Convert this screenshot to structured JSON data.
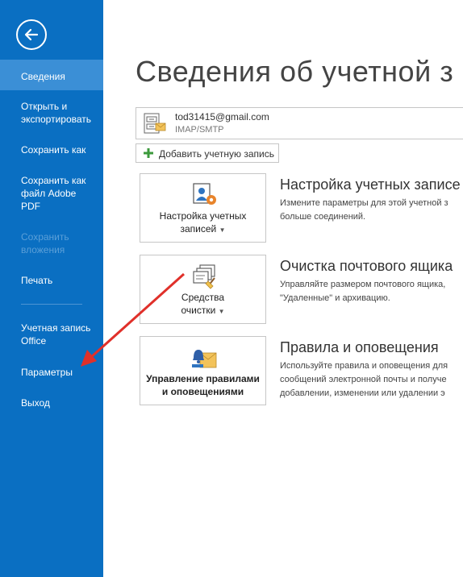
{
  "sidebar": {
    "back_icon": "back-arrow-icon",
    "items": [
      {
        "label": "Сведения"
      },
      {
        "label": "Открыть и экспортировать"
      },
      {
        "label": "Сохранить как"
      },
      {
        "label": "Сохранить как файл Adobe PDF"
      },
      {
        "label": "Сохранить вложения"
      },
      {
        "label": "Печать"
      },
      {
        "label": "Учетная запись Office"
      },
      {
        "label": "Параметры"
      },
      {
        "label": "Выход"
      }
    ]
  },
  "main": {
    "title": "Сведения об учетной з",
    "account": {
      "email": "tod31415@gmail.com",
      "type": "IMAP/SMTP"
    },
    "add_account_label": "Добавить учетную запись",
    "sections": [
      {
        "tile_label_1": "Настройка учетных",
        "tile_label_2": "записей",
        "title": "Настройка учетных записе",
        "desc_1": "Измените параметры для этой учетной з",
        "desc_2": "больше соединений."
      },
      {
        "tile_label_1": "Средства",
        "tile_label_2": "очистки",
        "title": "Очистка почтового ящика",
        "desc_1": "Управляйте размером почтового ящика,",
        "desc_2": "\"Удаленные\" и архивацию."
      },
      {
        "tile_label_1": "Управление правилами",
        "tile_label_2": "и оповещениями",
        "title": "Правила и оповещения",
        "desc_1": "Используйте правила и оповещения для",
        "desc_2": "сообщений электронной почты и получе",
        "desc_3": "добавлении, изменении или удалении э"
      }
    ]
  },
  "colors": {
    "sidebar_bg": "#0a6fc2",
    "sidebar_active": "#3b8fd6",
    "annotation_arrow": "#e0302a"
  }
}
